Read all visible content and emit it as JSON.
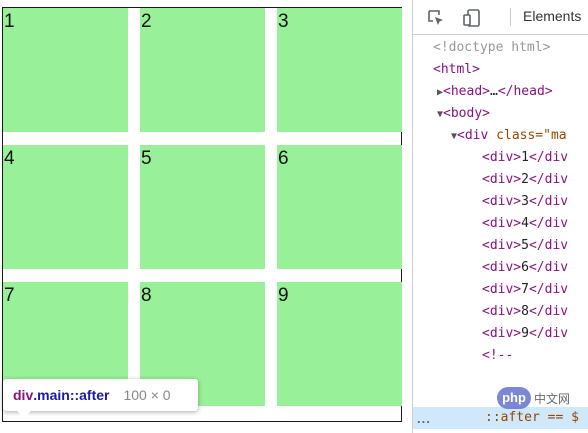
{
  "grid": {
    "cells": [
      "1",
      "2",
      "3",
      "4",
      "5",
      "6",
      "7",
      "8",
      "9"
    ],
    "cell_color": "#98f098"
  },
  "tooltip": {
    "tag": "div",
    "class": ".main",
    "pseudo": "::after",
    "size": "100 × 0"
  },
  "devtools": {
    "tab_label": "Elements",
    "toolbar_icons": [
      "inspect-cursor-icon",
      "device-toolbar-icon"
    ],
    "lines": {
      "doctype": "<!doctype html>",
      "html_open": "<html>",
      "head_open": "<head>",
      "head_ellipsis": "…",
      "head_close": "</head>",
      "body_open": "<body>",
      "div_open_tag": "<div ",
      "div_attr": "class=\"ma",
      "children": [
        {
          "open": "<div>",
          "text": "1",
          "close": "</div"
        },
        {
          "open": "<div>",
          "text": "2",
          "close": "</div"
        },
        {
          "open": "<div>",
          "text": "3",
          "close": "</div"
        },
        {
          "open": "<div>",
          "text": "4",
          "close": "</div"
        },
        {
          "open": "<div>",
          "text": "5",
          "close": "</div"
        },
        {
          "open": "<div>",
          "text": "6",
          "close": "</div"
        },
        {
          "open": "<div>",
          "text": "7",
          "close": "</div"
        },
        {
          "open": "<div>",
          "text": "8",
          "close": "</div"
        },
        {
          "open": "<div>",
          "text": "9",
          "close": "</div"
        }
      ],
      "comment": "<!--",
      "selected": "::after == $",
      "dots": "..."
    }
  },
  "watermark": {
    "badge": "php",
    "text": "中文网"
  }
}
